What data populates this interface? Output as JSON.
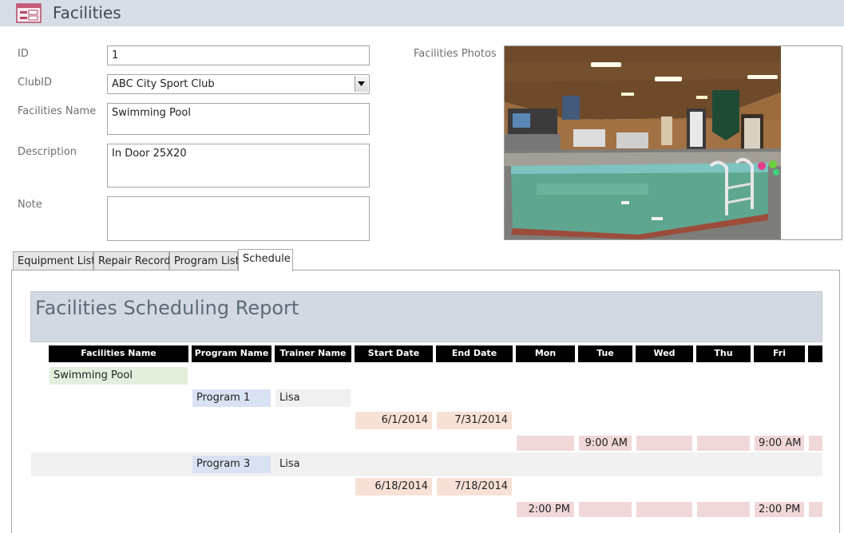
{
  "form": {
    "title": "Facilities",
    "icon": "form-icon"
  },
  "fields": {
    "id_label": "ID",
    "id_value": "1",
    "clubid_label": "ClubID",
    "clubid_value": "ABC City Sport Club",
    "name_label": "Facilities Name",
    "name_value": "Swimming Pool",
    "description_label": "Description",
    "description_value": "In Door 25X20",
    "note_label": "Note",
    "note_value": "",
    "photos_label": "Facilities Photos"
  },
  "tabs": [
    {
      "label": "Equipment List"
    },
    {
      "label": "Repair Record"
    },
    {
      "label": "Program List"
    },
    {
      "label": "Schedule",
      "active": true
    }
  ],
  "report": {
    "title": "Facilities Scheduling Report",
    "columns": [
      "Facilities Name",
      "Program Name",
      "Trainer Name",
      "Start Date",
      "End Date",
      "Mon",
      "Tue",
      "Wed",
      "Thu",
      "Fri",
      ""
    ],
    "facility": "Swimming Pool",
    "programs": [
      {
        "name": "Program 1",
        "trainer": "Lisa",
        "start": "6/1/2014",
        "end": "7/31/2014",
        "times": {
          "mon": "",
          "tue": "9:00 AM",
          "wed": "",
          "thu": "",
          "fri": "9:00 AM",
          "extra": ""
        }
      },
      {
        "name": "Program 3",
        "trainer": "Lisa",
        "start": "6/18/2014",
        "end": "7/18/2014",
        "times": {
          "mon": "2:00 PM",
          "tue": "",
          "wed": "",
          "thu": "",
          "fri": "2:00 PM",
          "extra": ""
        }
      }
    ]
  },
  "colors": {
    "header_bg": "#d7dde6",
    "report_header_bg": "#d3d9e2",
    "column_header_bg": "#000000",
    "facility_cell": "#e3efdc",
    "program_cell": "#d9e2f2",
    "date_cell": "#f7e1d6",
    "time_cell": "#f1d8d8"
  }
}
